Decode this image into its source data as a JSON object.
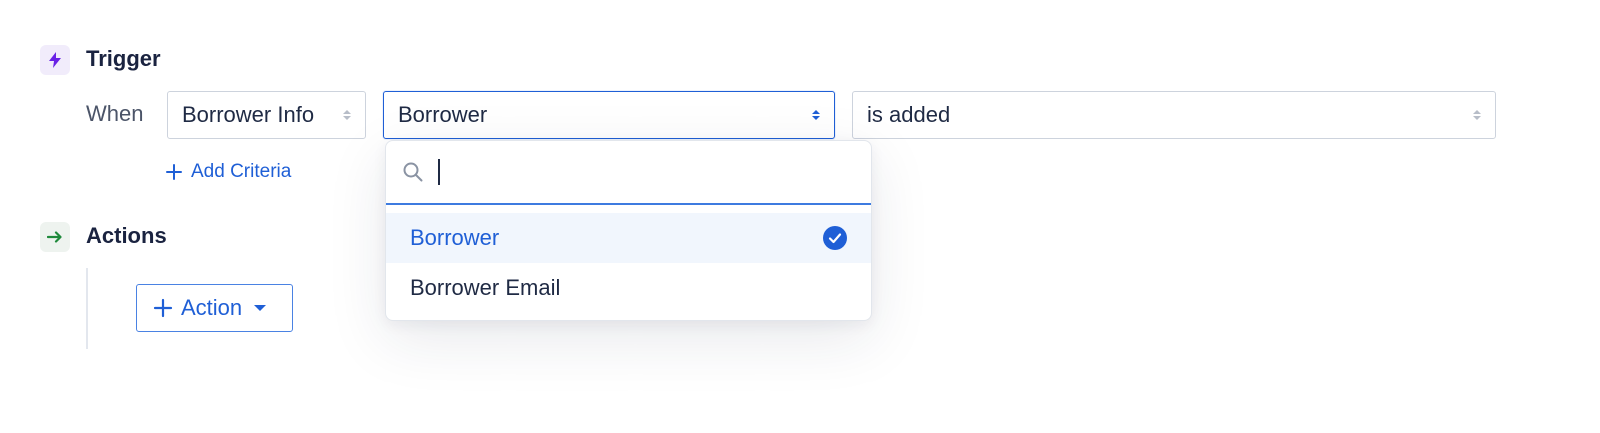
{
  "trigger": {
    "title": "Trigger",
    "icon": "bolt-icon",
    "when_label": "When",
    "entity_select": {
      "value": "Borrower Info"
    },
    "field_select": {
      "value": "Borrower"
    },
    "condition_select": {
      "value": "is added"
    },
    "add_criteria_label": "Add Criteria"
  },
  "actions": {
    "title": "Actions",
    "icon": "arrow-right-icon",
    "add_action_label": "Action"
  },
  "dropdown": {
    "search_placeholder": "",
    "options": [
      {
        "label": "Borrower",
        "selected": true
      },
      {
        "label": "Borrower Email",
        "selected": false
      }
    ]
  },
  "colors": {
    "accent": "#1f5fd6",
    "trigger_icon": "#7b2ff7",
    "actions_icon": "#1f8a3c"
  }
}
